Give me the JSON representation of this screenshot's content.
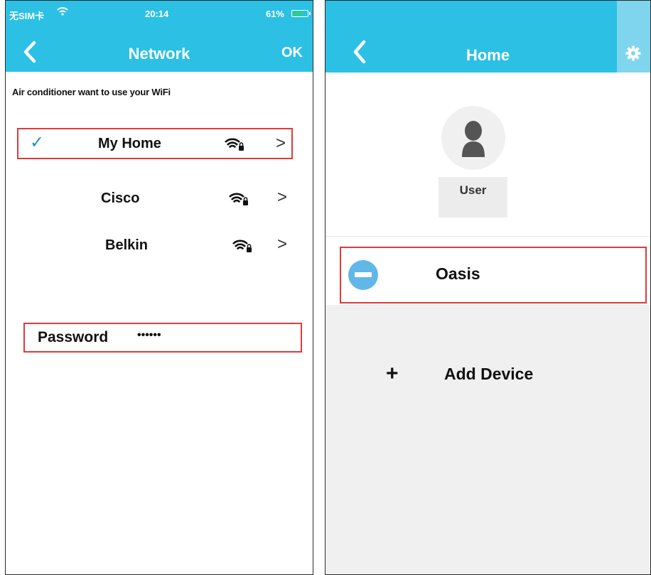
{
  "left_screen": {
    "status_bar": {
      "carrier": "无SIM卡",
      "time": "20:14",
      "battery": "61%"
    },
    "nav": {
      "title": "Network",
      "ok_label": "OK"
    },
    "prompt": "Air conditioner want to use your WiFi",
    "networks": [
      {
        "name": "My Home",
        "selected": true,
        "chevron": ">"
      },
      {
        "name": "Cisco",
        "selected": false,
        "chevron": ">"
      },
      {
        "name": "Belkin",
        "selected": false,
        "chevron": ">"
      }
    ],
    "check_mark": "✓",
    "password": {
      "label": "Password",
      "value": "••••••"
    }
  },
  "right_screen": {
    "nav": {
      "title": "Home"
    },
    "user": {
      "label": "User"
    },
    "devices": [
      {
        "name": "Oasis"
      }
    ],
    "add_device": {
      "icon": "+",
      "label": "Add Device"
    }
  },
  "colors": {
    "accent": "#2bc0e4",
    "highlight": "#e03a3a",
    "device_icon": "#61b8e8"
  }
}
